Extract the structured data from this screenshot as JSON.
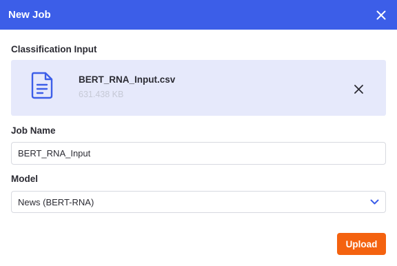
{
  "dialog": {
    "title": "New Job",
    "close_icon": "close-icon"
  },
  "classification": {
    "label": "Classification Input",
    "file": {
      "name": "BERT_RNA_Input.csv",
      "size": "631.438 KB",
      "icon": "document-icon",
      "remove_icon": "close-icon"
    }
  },
  "job_name": {
    "label": "Job Name",
    "value": "BERT_RNA_Input"
  },
  "model": {
    "label": "Model",
    "selected": "News (BERT-RNA)",
    "icon": "chevron-down-icon"
  },
  "actions": {
    "upload_label": "Upload"
  },
  "colors": {
    "header": "#3c5ee8",
    "file_card": "#e6e9fb",
    "primary_action": "#f4620f",
    "icon_accent": "#3c5ee8"
  }
}
